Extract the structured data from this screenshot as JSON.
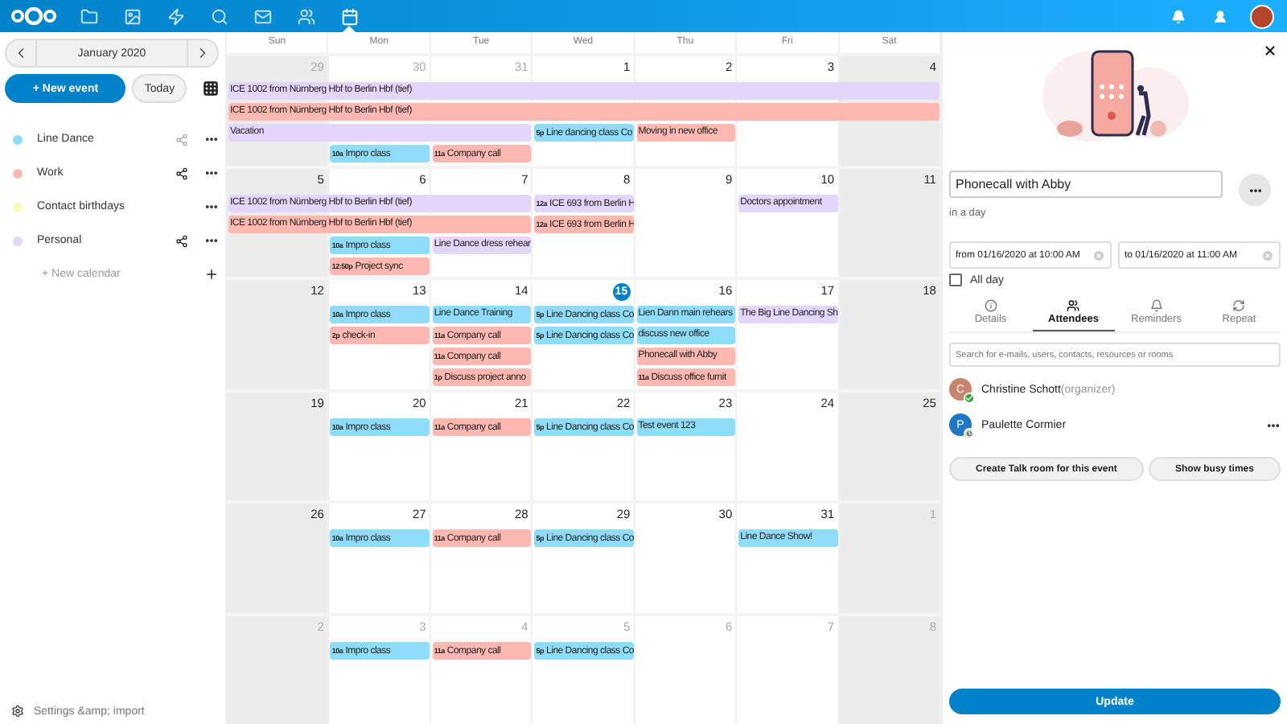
{
  "header": {
    "apps": [
      {
        "kind": "files",
        "selected": false
      },
      {
        "kind": "photos",
        "selected": false
      },
      {
        "kind": "activity",
        "selected": false
      },
      {
        "kind": "talk",
        "selected": false
      },
      {
        "kind": "mail",
        "selected": false
      },
      {
        "kind": "contacts",
        "selected": false
      },
      {
        "kind": "calendar",
        "selected": true
      }
    ],
    "tools": [
      {
        "kind": "notifications"
      },
      {
        "kind": "contacts-menu"
      }
    ]
  },
  "sidebar": {
    "month": "January 2020",
    "new_event": "+ New event",
    "today": "Today",
    "calendars": [
      {
        "name": "Line Dance",
        "color": "#8fdcf8",
        "shared": false
      },
      {
        "name": "Work",
        "color": "#fdb8b1",
        "shared": true
      },
      {
        "name": "Contact birthdays",
        "color": "#fdfbb8"
      },
      {
        "name": "Personal",
        "color": "#e4d6fb",
        "shared": true
      }
    ],
    "new_calendar": "+ New calendar",
    "settings": "Settings &amp; import"
  },
  "calendar": {
    "weekdays": [
      "Sun",
      "Mon",
      "Tue",
      "Wed",
      "Thu",
      "Fri",
      "Sat"
    ],
    "weeks": [
      {
        "days": [
          {
            "number": "29",
            "muted": true,
            "events": [
              {
                "kind": "event",
                "title": "ICE 1002 from Nürnberg Hbf to Berlin Hbf (tief)",
                "color": "#e4d6fb"
              },
              {
                "kind": "event",
                "title": "ICE 1002 from Nürnberg Hbf to Berlin Hbf (tief)",
                "color": "#fdb8b1"
              },
              {
                "kind": "event",
                "title": "Vacation",
                "color": "#e4d6fb"
              }
            ]
          },
          {
            "number": "30",
            "muted": true,
            "events": [
              {
                "kind": "continuation"
              },
              {
                "kind": "continuation"
              },
              {
                "kind": "continuation"
              },
              {
                "kind": "event",
                "time": "10a",
                "title": "Impro class",
                "color": "#8fdcf8"
              }
            ]
          },
          {
            "number": "31",
            "muted": true,
            "events": [
              {
                "kind": "continuation"
              },
              {
                "kind": "continuation"
              },
              {
                "kind": "continuation"
              },
              {
                "kind": "event",
                "time": "11a",
                "title": "Company call",
                "color": "#fdb8b1"
              }
            ]
          },
          {
            "number": "1",
            "muted": false,
            "events": [
              {
                "kind": "continuation"
              },
              {
                "kind": "continuation"
              },
              {
                "kind": "event",
                "time": "5p",
                "title": "Line dancing class Co",
                "color": "#8fdcf8"
              }
            ]
          },
          {
            "number": "2",
            "muted": false,
            "events": [
              {
                "kind": "continuation"
              },
              {
                "kind": "continuation"
              },
              {
                "kind": "event",
                "title": "Moving in new office",
                "color": "#fdb8b1"
              }
            ]
          },
          {
            "number": "3",
            "muted": false,
            "events": [
              {
                "kind": "continuation"
              },
              {
                "kind": "continuation"
              }
            ]
          },
          {
            "number": "4",
            "muted": false,
            "events": [
              {
                "kind": "continuation"
              },
              {
                "kind": "continuation"
              }
            ]
          }
        ]
      },
      {
        "days": [
          {
            "number": "5",
            "muted": false,
            "events": [
              {
                "kind": "event",
                "title": "ICE 1002 from Nürnberg Hbf to Berlin Hbf (tief)",
                "color": "#e4d6fb"
              },
              {
                "kind": "event",
                "title": "ICE 1002 from Nürnberg Hbf to Berlin Hbf (tief)",
                "color": "#fdb8b1"
              }
            ]
          },
          {
            "number": "6",
            "muted": false,
            "events": [
              {
                "kind": "continuation"
              },
              {
                "kind": "continuation"
              },
              {
                "kind": "event",
                "time": "10a",
                "title": "Impro class",
                "color": "#8fdcf8"
              },
              {
                "kind": "event",
                "time": "12:50p",
                "title": "Project sync",
                "color": "#fdb8b1"
              }
            ]
          },
          {
            "number": "7",
            "muted": false,
            "events": [
              {
                "kind": "continuation"
              },
              {
                "kind": "continuation"
              },
              {
                "kind": "event",
                "title": "Line Dance dress rehear",
                "color": "#e4d6fb"
              }
            ]
          },
          {
            "number": "8",
            "muted": false,
            "events": [
              {
                "kind": "event",
                "time": "12a",
                "title": "ICE 693 from Berlin H",
                "color": "#e4d6fb"
              },
              {
                "kind": "event",
                "time": "12a",
                "title": "ICE 693 from Berlin H",
                "color": "#fdb8b1"
              }
            ]
          },
          {
            "number": "9",
            "muted": false
          },
          {
            "number": "10",
            "muted": false,
            "events": [
              {
                "kind": "event",
                "title": "Doctors appointment",
                "color": "#e4d6fb"
              }
            ]
          },
          {
            "number": "11",
            "muted": false
          }
        ]
      },
      {
        "days": [
          {
            "number": "12",
            "muted": false
          },
          {
            "number": "13",
            "muted": false,
            "events": [
              {
                "kind": "event",
                "time": "10a",
                "title": "Impro class",
                "color": "#8fdcf8"
              },
              {
                "kind": "event",
                "time": "2p",
                "title": "check-in",
                "color": "#fdb8b1"
              }
            ]
          },
          {
            "number": "14",
            "muted": false,
            "events": [
              {
                "kind": "event",
                "title": "Line Dance Training",
                "color": "#8fdcf8"
              },
              {
                "kind": "event",
                "time": "11a",
                "title": "Company call",
                "color": "#fdb8b1"
              },
              {
                "kind": "event",
                "time": "11a",
                "title": "Company call",
                "color": "#fdb8b1"
              },
              {
                "kind": "event",
                "time": "1p",
                "title": "Discuss project anno",
                "color": "#fdb8b1"
              }
            ]
          },
          {
            "number": "15",
            "muted": false,
            "today": true,
            "events": [
              {
                "kind": "event",
                "time": "5p",
                "title": "Line Dancing class Co",
                "color": "#8fdcf8"
              },
              {
                "kind": "event",
                "time": "5p",
                "title": "Line Dancing class Co",
                "color": "#8fdcf8"
              }
            ]
          },
          {
            "number": "16",
            "muted": false,
            "events": [
              {
                "kind": "event",
                "title": "Lien Dann main rehears",
                "color": "#8fdcf8"
              },
              {
                "kind": "event",
                "title": "discuss new office",
                "color": "#8fdcf8"
              },
              {
                "kind": "event",
                "title": "Phonecall with Abby",
                "color": "#fdb8b1"
              },
              {
                "kind": "event",
                "time": "11a",
                "title": "Discuss office furnit",
                "color": "#fdb8b1"
              }
            ]
          },
          {
            "number": "17",
            "muted": false,
            "events": [
              {
                "kind": "event",
                "title": "The Big Line Dancing Sh",
                "color": "#e4d6fb"
              }
            ]
          },
          {
            "number": "18",
            "muted": false
          }
        ]
      },
      {
        "days": [
          {
            "number": "19",
            "muted": false
          },
          {
            "number": "20",
            "muted": false,
            "events": [
              {
                "kind": "event",
                "time": "10a",
                "title": "Impro class",
                "color": "#8fdcf8"
              }
            ]
          },
          {
            "number": "21",
            "muted": false,
            "events": [
              {
                "kind": "event",
                "time": "11a",
                "title": "Company call",
                "color": "#fdb8b1"
              }
            ]
          },
          {
            "number": "22",
            "muted": false,
            "events": [
              {
                "kind": "event",
                "time": "5p",
                "title": "Line Dancing class Co",
                "color": "#8fdcf8"
              }
            ]
          },
          {
            "number": "23",
            "muted": false,
            "events": [
              {
                "kind": "event",
                "title": "Test event 123",
                "color": "#8fdcf8"
              }
            ]
          },
          {
            "number": "24",
            "muted": false
          },
          {
            "number": "25",
            "muted": false
          }
        ]
      },
      {
        "days": [
          {
            "number": "26",
            "muted": false
          },
          {
            "number": "27",
            "muted": false,
            "events": [
              {
                "kind": "event",
                "time": "10a",
                "title": "Impro class",
                "color": "#8fdcf8"
              }
            ]
          },
          {
            "number": "28",
            "muted": false,
            "events": [
              {
                "kind": "event",
                "time": "11a",
                "title": "Company call",
                "color": "#fdb8b1"
              }
            ]
          },
          {
            "number": "29",
            "muted": false,
            "events": [
              {
                "kind": "event",
                "time": "5p",
                "title": "Line Dancing class Co",
                "color": "#8fdcf8"
              }
            ]
          },
          {
            "number": "30",
            "muted": false
          },
          {
            "number": "31",
            "muted": false,
            "events": [
              {
                "kind": "event",
                "title": "Line Dance Show!",
                "color": "#8fdcf8"
              }
            ]
          },
          {
            "number": "1",
            "muted": true
          }
        ]
      },
      {
        "days": [
          {
            "number": "2",
            "muted": true
          },
          {
            "number": "3",
            "muted": true,
            "events": [
              {
                "kind": "event",
                "time": "10a",
                "title": "Impro class",
                "color": "#8fdcf8"
              }
            ]
          },
          {
            "number": "4",
            "muted": true,
            "events": [
              {
                "kind": "event",
                "time": "11a",
                "title": "Company call",
                "color": "#fdb8b1"
              }
            ]
          },
          {
            "number": "5",
            "muted": true,
            "events": [
              {
                "kind": "event",
                "time": "5p",
                "title": "Line Dancing class Co",
                "color": "#8fdcf8"
              }
            ]
          },
          {
            "number": "6",
            "muted": true
          },
          {
            "number": "7",
            "muted": true
          },
          {
            "number": "8",
            "muted": true
          }
        ]
      }
    ]
  },
  "editor": {
    "title": "Phonecall with Abby",
    "relative": "in a day",
    "from": "from 01/16/2020 at 10:00 AM",
    "to": "to 01/16/2020 at 11:00 AM",
    "all_day": {
      "label": "All day",
      "checked": false
    },
    "tabs": [
      {
        "kind": "details",
        "label": "Details",
        "selected": false
      },
      {
        "kind": "attendees",
        "label": "Attendees",
        "selected": true
      },
      {
        "kind": "reminders",
        "label": "Reminders",
        "selected": false
      },
      {
        "kind": "repeat",
        "label": "Repeat",
        "selected": false
      }
    ],
    "search": {
      "placeholder": "Search for e-mails, users, contacts, resources or rooms"
    },
    "attendees": [
      {
        "initial": "C",
        "name": "Christine Schott",
        "role": "(organizer)",
        "color": "#c98470",
        "accepted": true,
        "menu": false
      },
      {
        "initial": "P",
        "name": "Paulette Cormier",
        "color": "#1f78c4",
        "accepted": false,
        "menu": true
      }
    ],
    "buttons": [
      "Create Talk room for this event",
      "Show busy times"
    ],
    "update": "Update"
  }
}
